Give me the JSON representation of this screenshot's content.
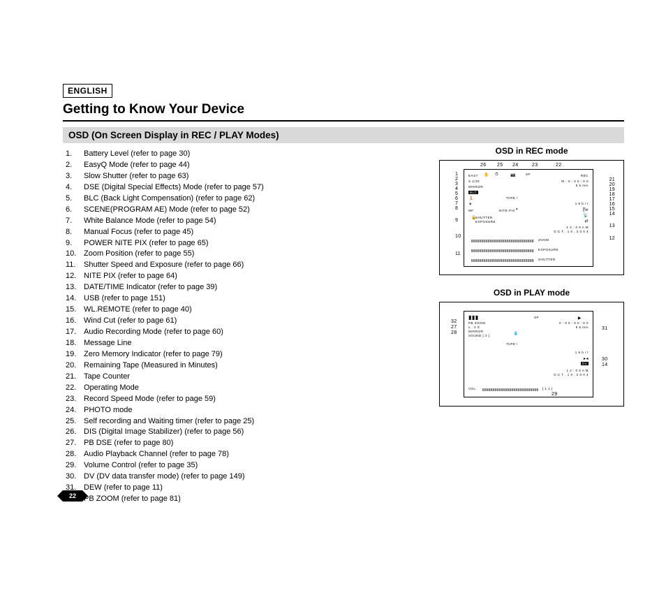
{
  "lang": "ENGLISH",
  "title": "Getting to Know Your Device",
  "subtitle": "OSD (On Screen Display in REC / PLAY Modes)",
  "page_num": "22",
  "list": [
    "Battery Level (refer to page 30)",
    "EasyQ Mode (refer to page 44)",
    "Slow Shutter (refer to page 63)",
    "DSE (Digital Special Effects) Mode (refer to page 57)",
    "BLC (Back Light Compensation) (refer to page 62)",
    "SCENE(PROGRAM AE) Mode (refer to page 52)",
    "White Balance Mode (refer to page 54)",
    "Manual Focus (refer to page 45)",
    "POWER NITE PIX (refer to page 65)",
    "Zoom Position (refer to page 55)",
    "Shutter Speed and Exposure (refer to page 66)",
    "NITE PIX (refer to page 64)",
    "DATE/TIME Indicator (refer to page 39)",
    "USB (refer to page 151)",
    "WL.REMOTE (refer to page 40)",
    "Wind Cut (refer to page 61)",
    "Audio Recording Mode (refer to page 60)",
    "Message Line",
    "Zero Memory Indicator (refer to page 79)",
    "Remaining Tape (Measured in Minutes)",
    "Tape Counter",
    "Operating Mode",
    "Record Speed Mode (refer to page 59)",
    "PHOTO mode",
    "Self recording and Waiting timer (refer to page 25)",
    "DIS (Digital Image Stabilizer) (refer to page 56)",
    "PB DSE (refer to page 80)",
    "Audio Playback Channel (refer to page 78)",
    "Volume Control (refer to page 35)",
    "DV (DV data transfer mode) (refer to page 149)",
    "DEW (refer to page 11)",
    "PB ZOOM (refer to page 81)"
  ],
  "rec": {
    "title": "OSD in REC mode",
    "left_callouts": [
      "1",
      "2",
      "3",
      "4",
      "5",
      "6",
      "7",
      "8",
      "9",
      "10",
      "11"
    ],
    "top_callouts": [
      "26",
      "25",
      "24",
      "23",
      "22"
    ],
    "right_callouts": [
      "21",
      "20",
      "19",
      "18",
      "17",
      "16",
      "15",
      "14",
      "13",
      "12"
    ],
    "screen": {
      "row1_left": "EASY",
      "row1_right": "REC",
      "row2_left": "S.1/30",
      "row2_right_a": "M - 0 : 0 0 : 0 0",
      "row2_right_b": "5 5 min",
      "row3_left": "MIRROR",
      "row4_left": "BLC",
      "row4_mid": "TAPE !",
      "row6_right": "1 6 b i t",
      "row7_left": "MF",
      "row7_mid": "NITE PIX",
      "row8_left_a": "SHUTTER",
      "row8_left_b": "EXPOSURE",
      "row8_right_a": "1 2 : 0 0 A M",
      "row8_right_b": "O C T . 1 0 , 2 0 0 4",
      "bar1": "ZOOM",
      "bar2": "EXPOSURE",
      "bar3": "SHUTTER"
    }
  },
  "play": {
    "title": "OSD in PLAY mode",
    "left_callouts": [
      "32",
      "27",
      "28"
    ],
    "right_callouts": [
      "31",
      "30",
      "14",
      "29"
    ],
    "screen": {
      "row1_left_a": "PB ZOOM",
      "row1_left_b": "x . 3 X",
      "row1_right_a": "0 : 0 0 : 0 0 : 0 0",
      "row1_right_b": "5 5 min",
      "row2_left_a": "MIRROR",
      "row2_left_b": "SOUND [ 2 ]",
      "row4_mid": "TAPE !",
      "row6_right": "1 6 b i t",
      "row7_right": "DV",
      "row8_right_a": "1 2 : 0 0 A M",
      "row8_right_b": "O C T . 1 0 , 2 0 0 4",
      "bar_left": "VOL.",
      "bar_right": "[ 1 1 ]"
    }
  }
}
